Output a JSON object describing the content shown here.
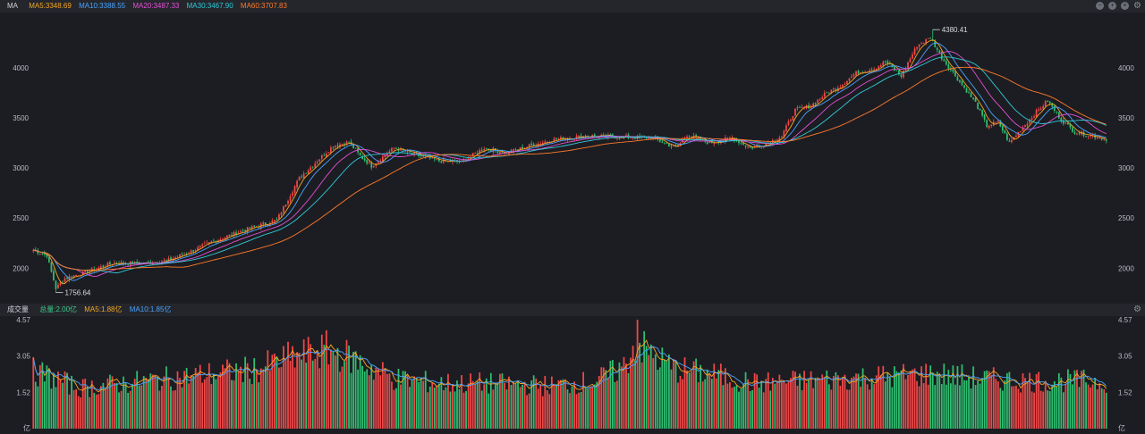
{
  "price_panel": {
    "label": "MA",
    "legend": [
      {
        "text": "MA5:3348.69",
        "color": "#f5a623"
      },
      {
        "text": "MA10:3388.55",
        "color": "#4aa3ff"
      },
      {
        "text": "MA20:3487.33",
        "color": "#e44fd5"
      },
      {
        "text": "MA30:3467.90",
        "color": "#2ec9d6"
      },
      {
        "text": "MA60:3707.83",
        "color": "#ff7a2a"
      }
    ],
    "icons": [
      "minus-icon",
      "plus-icon",
      "close-icon",
      "gear-icon"
    ],
    "high_label": "4380.41",
    "low_label": "1756.64",
    "y_ticks": [
      "4000",
      "3500",
      "3000",
      "2500",
      "2000"
    ]
  },
  "volume_panel": {
    "label": "成交量",
    "legend": [
      {
        "text": "总量:2.00亿",
        "color": "#3ec98a"
      },
      {
        "text": "MA5:1.88亿",
        "color": "#f5a623"
      },
      {
        "text": "MA10:1.85亿",
        "color": "#4aa3ff"
      }
    ],
    "y_ticks": [
      "4.57",
      "3.05",
      "1.52"
    ],
    "unit": "亿"
  },
  "colors": {
    "up": "#f04848",
    "down": "#2fbf71",
    "ma5": "#f5a623",
    "ma10": "#4aa3ff",
    "ma20": "#e44fd5",
    "ma30": "#2ec9d6",
    "ma60": "#ff7a2a"
  },
  "chart_data": [
    {
      "type": "candlestick",
      "ylim": [
        1700,
        4480
      ],
      "y_ticks": [
        4000,
        3500,
        3000,
        2500,
        2000
      ],
      "grid": false,
      "close_anchors": [
        [
          0,
          2180
        ],
        [
          6,
          2130
        ],
        [
          8,
          1960
        ],
        [
          10,
          1800
        ],
        [
          14,
          1900
        ],
        [
          22,
          1950
        ],
        [
          35,
          2050
        ],
        [
          50,
          2050
        ],
        [
          60,
          2080
        ],
        [
          70,
          2170
        ],
        [
          80,
          2270
        ],
        [
          95,
          2390
        ],
        [
          108,
          2480
        ],
        [
          118,
          2900
        ],
        [
          125,
          3050
        ],
        [
          133,
          3220
        ],
        [
          140,
          3260
        ],
        [
          145,
          3120
        ],
        [
          150,
          3020
        ],
        [
          160,
          3200
        ],
        [
          170,
          3130
        ],
        [
          180,
          3070
        ],
        [
          190,
          3060
        ],
        [
          200,
          3200
        ],
        [
          210,
          3150
        ],
        [
          220,
          3220
        ],
        [
          230,
          3280
        ],
        [
          245,
          3320
        ],
        [
          260,
          3310
        ],
        [
          275,
          3300
        ],
        [
          285,
          3200
        ],
        [
          290,
          3330
        ],
        [
          300,
          3250
        ],
        [
          310,
          3300
        ],
        [
          318,
          3200
        ],
        [
          325,
          3240
        ],
        [
          332,
          3320
        ],
        [
          338,
          3580
        ],
        [
          345,
          3620
        ],
        [
          352,
          3750
        ],
        [
          358,
          3820
        ],
        [
          365,
          3950
        ],
        [
          373,
          3990
        ],
        [
          378,
          4060
        ],
        [
          385,
          3920
        ],
        [
          392,
          4220
        ],
        [
          398,
          4300
        ],
        [
          403,
          4100
        ],
        [
          408,
          3950
        ],
        [
          413,
          3800
        ],
        [
          418,
          3650
        ],
        [
          423,
          3420
        ],
        [
          428,
          3460
        ],
        [
          433,
          3250
        ],
        [
          438,
          3380
        ],
        [
          445,
          3560
        ],
        [
          450,
          3670
        ],
        [
          456,
          3480
        ],
        [
          462,
          3360
        ],
        [
          470,
          3320
        ],
        [
          476,
          3290
        ]
      ],
      "n_days": 477,
      "high": 4380.41,
      "low": 1756.64,
      "ma_periods": [
        5,
        10,
        20,
        30,
        60
      ]
    },
    {
      "type": "bar",
      "ylim": [
        0,
        4.57
      ],
      "y_ticks": [
        4.57,
        3.05,
        1.52
      ],
      "unit": "亿",
      "volume_anchors": [
        [
          0,
          2.4
        ],
        [
          10,
          2.1
        ],
        [
          20,
          1.7
        ],
        [
          40,
          1.9
        ],
        [
          60,
          2.1
        ],
        [
          80,
          2.3
        ],
        [
          100,
          2.5
        ],
        [
          115,
          3.0
        ],
        [
          130,
          3.3
        ],
        [
          140,
          3.0
        ],
        [
          160,
          2.1
        ],
        [
          180,
          1.9
        ],
        [
          200,
          1.9
        ],
        [
          230,
          1.8
        ],
        [
          250,
          2.0
        ],
        [
          262,
          2.6
        ],
        [
          268,
          3.7
        ],
        [
          272,
          3.2
        ],
        [
          285,
          2.5
        ],
        [
          300,
          2.3
        ],
        [
          320,
          1.9
        ],
        [
          340,
          2.0
        ],
        [
          360,
          2.1
        ],
        [
          380,
          2.2
        ],
        [
          400,
          2.3
        ],
        [
          420,
          2.1
        ],
        [
          440,
          2.0
        ],
        [
          476,
          2.0
        ]
      ],
      "max_volume": 4.57
    }
  ]
}
